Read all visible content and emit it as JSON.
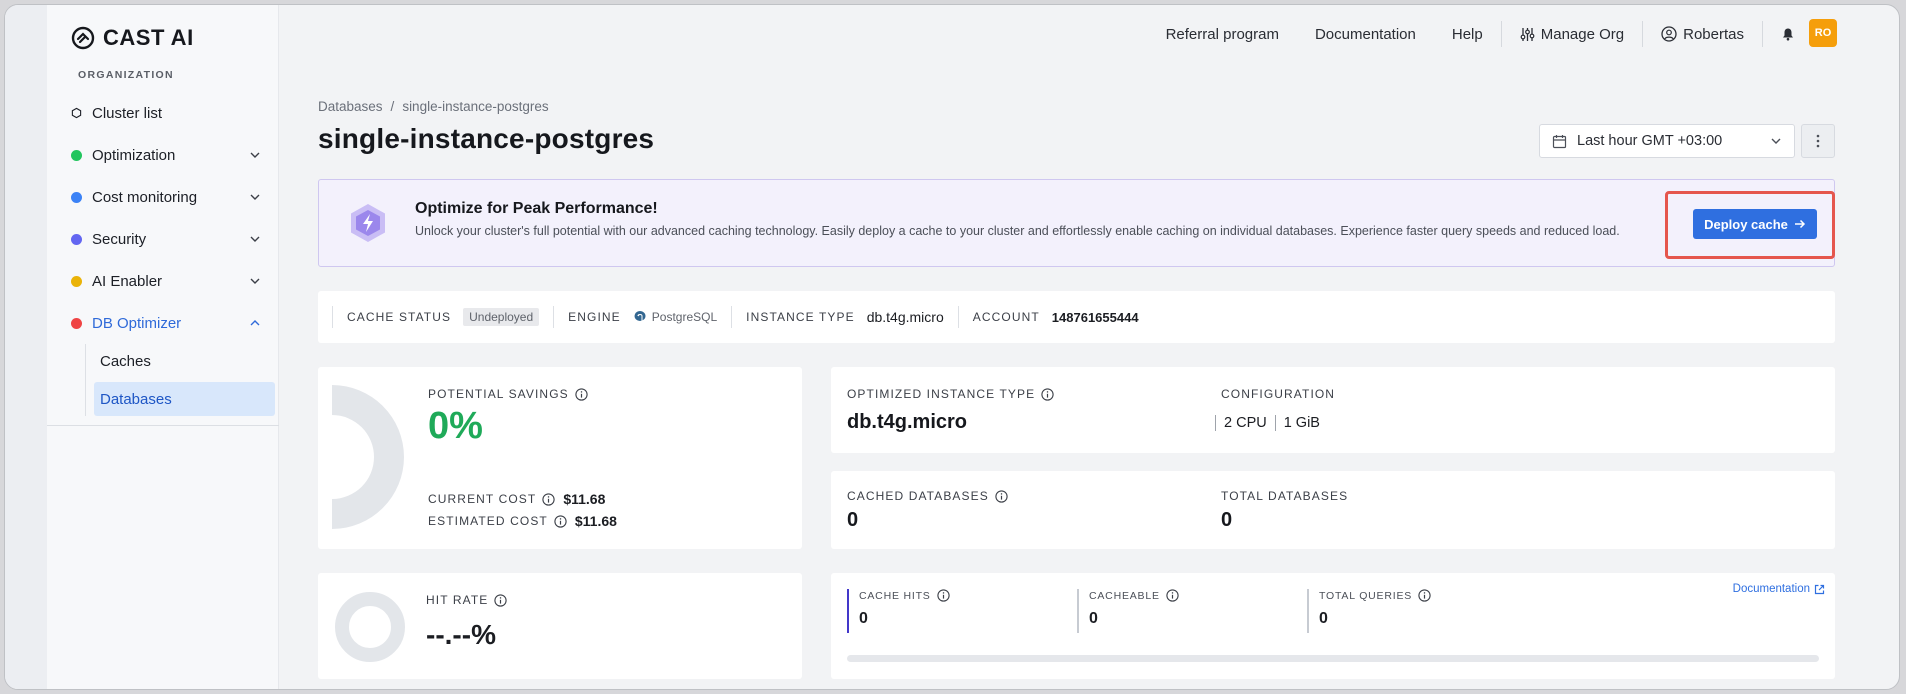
{
  "brand": {
    "name": "CAST AI"
  },
  "sidebar": {
    "org_label": "ORGANIZATION",
    "items": [
      {
        "label": "Cluster list",
        "color": "#6b7280"
      },
      {
        "label": "Optimization",
        "color": "#22c55e"
      },
      {
        "label": "Cost monitoring",
        "color": "#3b82f6"
      },
      {
        "label": "Security",
        "color": "#6366f1"
      },
      {
        "label": "AI Enabler",
        "color": "#eab308"
      },
      {
        "label": "DB Optimizer",
        "color": "#ef4444"
      }
    ],
    "sub_items": [
      {
        "label": "Caches"
      },
      {
        "label": "Databases"
      }
    ]
  },
  "topnav": {
    "referral": "Referral program",
    "documentation": "Documentation",
    "help": "Help",
    "manage_org": "Manage Org",
    "user": "Robertas",
    "avatar_initials": "RO"
  },
  "breadcrumb": {
    "root": "Databases",
    "sep": "/",
    "current": "single-instance-postgres"
  },
  "page": {
    "title": "single-instance-postgres",
    "time_range": "Last hour GMT +03:00"
  },
  "banner": {
    "title": "Optimize for Peak Performance!",
    "text": "Unlock your cluster's full potential with our advanced caching technology. Easily deploy a cache to your cluster and effortlessly enable caching on individual databases. Experience faster query speeds and reduced load.",
    "button": "Deploy cache"
  },
  "status": {
    "cache_status_label": "CACHE STATUS",
    "cache_status_value": "Undeployed",
    "engine_label": "ENGINE",
    "engine_value": "PostgreSQL",
    "instance_type_label": "INSTANCE TYPE",
    "instance_type_value": "db.t4g.micro",
    "account_label": "ACCOUNT",
    "account_value": "148761655444"
  },
  "savings": {
    "label": "POTENTIAL SAVINGS",
    "value": "0%",
    "current_cost_label": "CURRENT COST",
    "current_cost_value": "$11.68",
    "estimated_cost_label": "ESTIMATED COST",
    "estimated_cost_value": "$11.68"
  },
  "optimized": {
    "label": "OPTIMIZED INSTANCE TYPE",
    "value": "db.t4g.micro",
    "config_label": "CONFIGURATION",
    "cpu": "2 CPU",
    "memory": "1 GiB"
  },
  "databases": {
    "cached_label": "CACHED DATABASES",
    "cached_value": "0",
    "total_label": "TOTAL DATABASES",
    "total_value": "0"
  },
  "hitrate": {
    "label": "HIT RATE",
    "value": "--.--%"
  },
  "queries": {
    "cache_hits_label": "CACHE HITS",
    "cache_hits_value": "0",
    "cacheable_label": "CACHEABLE",
    "cacheable_value": "0",
    "total_label": "TOTAL QUERIES",
    "total_value": "0",
    "doc_link": "Documentation",
    "progress_fraction": 0
  }
}
